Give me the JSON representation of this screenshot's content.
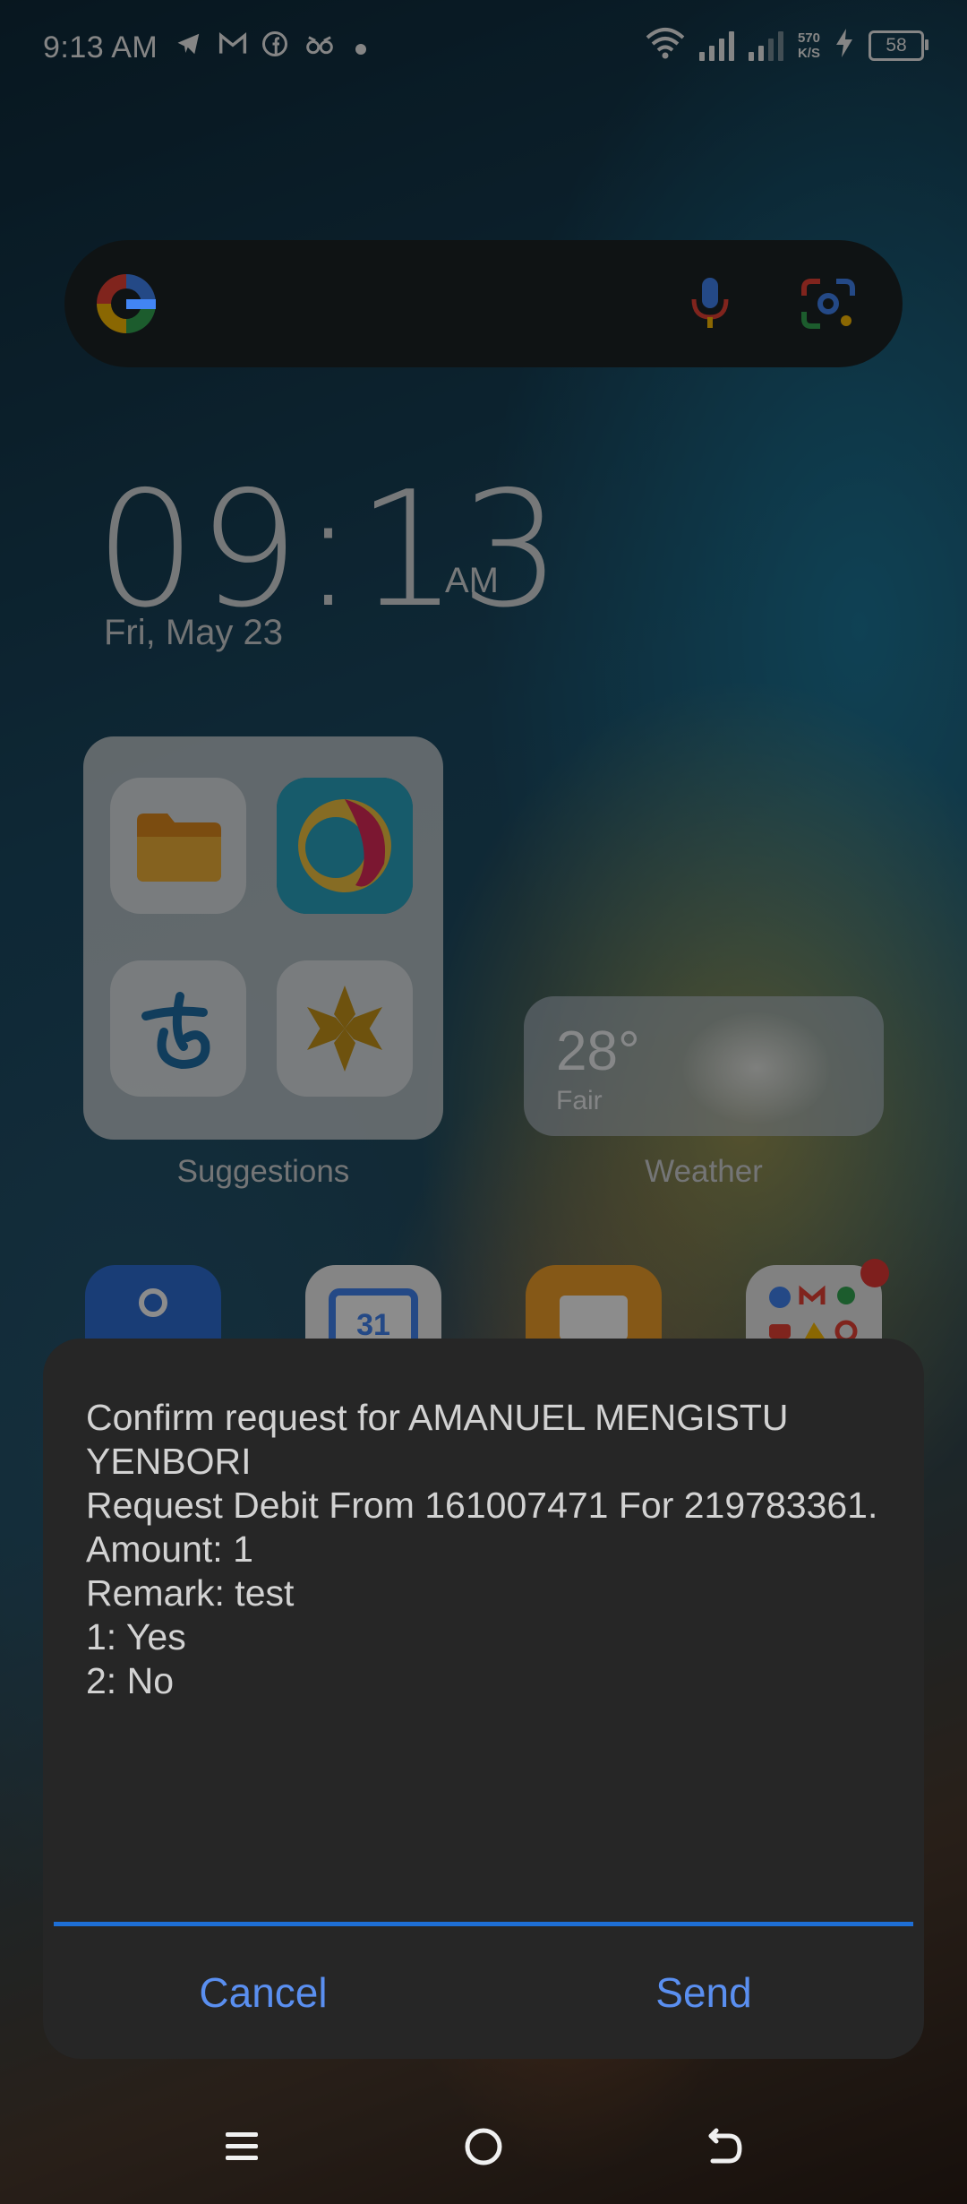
{
  "status_bar": {
    "time": "9:13 AM",
    "net_speed_value": "570",
    "net_speed_unit": "K/S",
    "battery": "58",
    "left_icons": [
      "telegram-icon",
      "gmail-icon",
      "facebook-icon",
      "infinity-icon",
      "dot-icon"
    ]
  },
  "clock_widget": {
    "time": "09:13",
    "ampm": "AM",
    "date": "Fri, May 23"
  },
  "suggestions": {
    "label": "Suggestions",
    "apps": [
      "files-icon",
      "browser-icon",
      "app-blue-icon",
      "app-gold-icon"
    ]
  },
  "weather": {
    "temperature": "28°",
    "condition": "Fair",
    "label": "Weather"
  },
  "dialog": {
    "message": "Confirm request for AMANUEL MENGISTU YENBORI\nRequest Debit From 161007471 For 219783361.\nAmount: 1\nRemark: test\n1: Yes\n2: No",
    "input_value": "",
    "cancel_label": "Cancel",
    "send_label": "Send",
    "accent_color": "#1e6fd6",
    "button_color": "#5a8ff0"
  }
}
